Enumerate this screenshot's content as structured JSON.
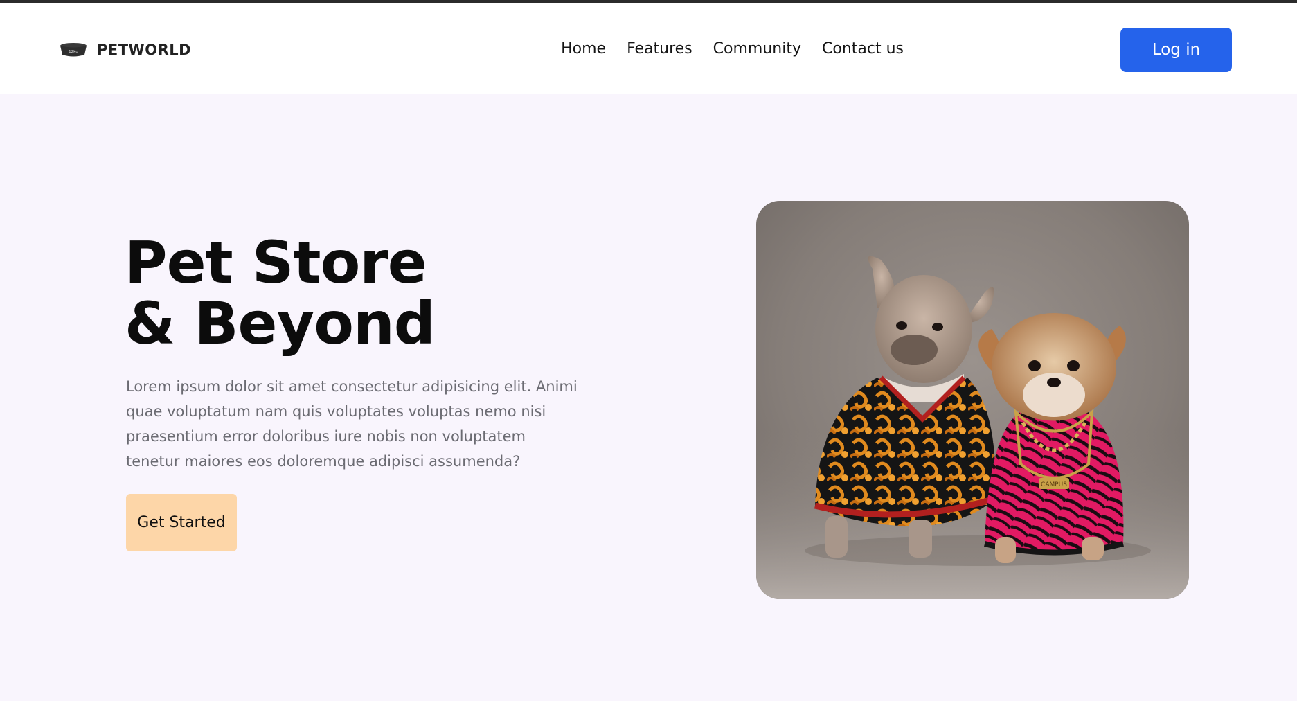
{
  "brand": {
    "name": "PETWORLD",
    "icon": "pet-bowl-icon",
    "icon_text": "12kg"
  },
  "nav": {
    "links": [
      "Home",
      "Features",
      "Community",
      "Contact us"
    ],
    "login_label": "Log in"
  },
  "hero": {
    "title_line1": "Pet Store",
    "title_line2": "& Beyond",
    "description": "Lorem ipsum dolor sit amet consectetur adipisicing elit. Animi quae voluptatum nam quis voluptates voluptas nemo nisi praesentium error doloribus iure nobis non voluptatem tenetur maiores eos doloremque adipisci assumenda?",
    "cta_label": "Get Started",
    "image_tag_text": "CAMPUS"
  },
  "colors": {
    "primary": "#2563eb",
    "hero_background": "#f9f5fd",
    "cta_background": "#fdd6a8",
    "text_dark": "#0c0c0c",
    "text_muted": "#6b6b72"
  }
}
